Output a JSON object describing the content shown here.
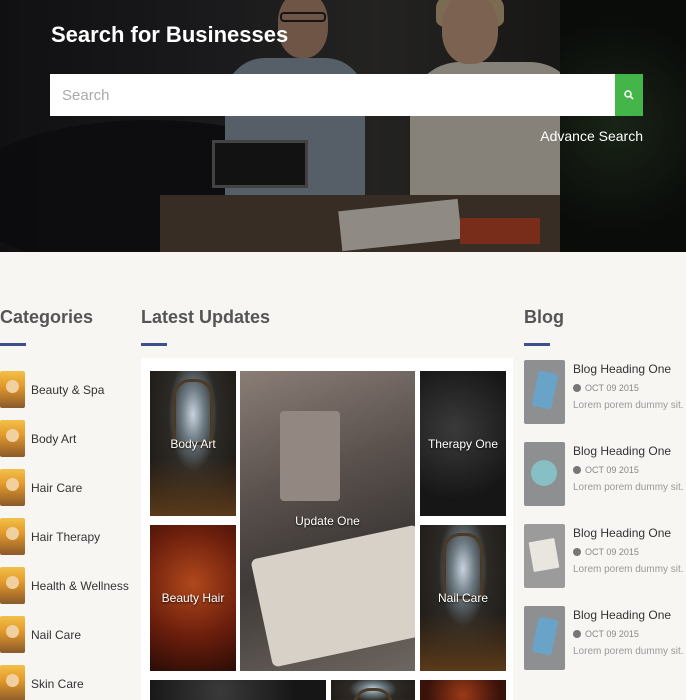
{
  "hero": {
    "title": "Search for Businesses",
    "search_placeholder": "Search",
    "advance_label": "Advance Search",
    "accent": "#44b549"
  },
  "categories": {
    "title": "Categories",
    "items": [
      {
        "label": "Beauty & Spa"
      },
      {
        "label": "Body Art"
      },
      {
        "label": "Hair Care"
      },
      {
        "label": "Hair Therapy"
      },
      {
        "label": "Health & Wellness"
      },
      {
        "label": "Nail Care"
      },
      {
        "label": "Skin Care"
      }
    ]
  },
  "updates": {
    "title": "Latest Updates",
    "tiles": [
      {
        "label": "Body Art"
      },
      {
        "label": "Update One"
      },
      {
        "label": "Therapy One"
      },
      {
        "label": "Beauty Hair"
      },
      {
        "label": "Nail Care"
      }
    ]
  },
  "blog": {
    "title": "Blog",
    "items": [
      {
        "heading": "Blog Heading One",
        "date": "OCT 09 2015",
        "text": "Lorem porem dummy sit."
      },
      {
        "heading": "Blog Heading One",
        "date": "OCT 09 2015",
        "text": "Lorem porem dummy sit."
      },
      {
        "heading": "Blog Heading One",
        "date": "OCT 09 2015",
        "text": "Lorem porem dummy sit."
      },
      {
        "heading": "Blog Heading One",
        "date": "OCT 09 2015",
        "text": "Lorem porem dummy sit."
      }
    ]
  },
  "colors": {
    "underline": "#3f4e8d",
    "page_bg": "#f7f6f3"
  }
}
